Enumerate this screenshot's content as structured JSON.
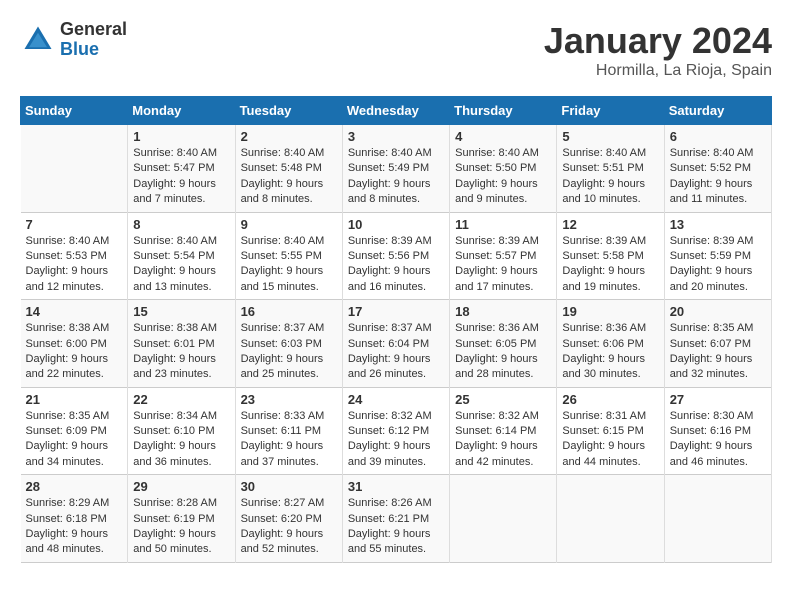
{
  "header": {
    "logo_general": "General",
    "logo_blue": "Blue",
    "month_title": "January 2024",
    "location": "Hormilla, La Rioja, Spain"
  },
  "days_of_week": [
    "Sunday",
    "Monday",
    "Tuesday",
    "Wednesday",
    "Thursday",
    "Friday",
    "Saturday"
  ],
  "weeks": [
    [
      {
        "day": "",
        "sunrise": "",
        "sunset": "",
        "daylight": ""
      },
      {
        "day": "1",
        "sunrise": "Sunrise: 8:40 AM",
        "sunset": "Sunset: 5:47 PM",
        "daylight": "Daylight: 9 hours and 7 minutes."
      },
      {
        "day": "2",
        "sunrise": "Sunrise: 8:40 AM",
        "sunset": "Sunset: 5:48 PM",
        "daylight": "Daylight: 9 hours and 8 minutes."
      },
      {
        "day": "3",
        "sunrise": "Sunrise: 8:40 AM",
        "sunset": "Sunset: 5:49 PM",
        "daylight": "Daylight: 9 hours and 8 minutes."
      },
      {
        "day": "4",
        "sunrise": "Sunrise: 8:40 AM",
        "sunset": "Sunset: 5:50 PM",
        "daylight": "Daylight: 9 hours and 9 minutes."
      },
      {
        "day": "5",
        "sunrise": "Sunrise: 8:40 AM",
        "sunset": "Sunset: 5:51 PM",
        "daylight": "Daylight: 9 hours and 10 minutes."
      },
      {
        "day": "6",
        "sunrise": "Sunrise: 8:40 AM",
        "sunset": "Sunset: 5:52 PM",
        "daylight": "Daylight: 9 hours and 11 minutes."
      }
    ],
    [
      {
        "day": "7",
        "sunrise": "Sunrise: 8:40 AM",
        "sunset": "Sunset: 5:53 PM",
        "daylight": "Daylight: 9 hours and 12 minutes."
      },
      {
        "day": "8",
        "sunrise": "Sunrise: 8:40 AM",
        "sunset": "Sunset: 5:54 PM",
        "daylight": "Daylight: 9 hours and 13 minutes."
      },
      {
        "day": "9",
        "sunrise": "Sunrise: 8:40 AM",
        "sunset": "Sunset: 5:55 PM",
        "daylight": "Daylight: 9 hours and 15 minutes."
      },
      {
        "day": "10",
        "sunrise": "Sunrise: 8:39 AM",
        "sunset": "Sunset: 5:56 PM",
        "daylight": "Daylight: 9 hours and 16 minutes."
      },
      {
        "day": "11",
        "sunrise": "Sunrise: 8:39 AM",
        "sunset": "Sunset: 5:57 PM",
        "daylight": "Daylight: 9 hours and 17 minutes."
      },
      {
        "day": "12",
        "sunrise": "Sunrise: 8:39 AM",
        "sunset": "Sunset: 5:58 PM",
        "daylight": "Daylight: 9 hours and 19 minutes."
      },
      {
        "day": "13",
        "sunrise": "Sunrise: 8:39 AM",
        "sunset": "Sunset: 5:59 PM",
        "daylight": "Daylight: 9 hours and 20 minutes."
      }
    ],
    [
      {
        "day": "14",
        "sunrise": "Sunrise: 8:38 AM",
        "sunset": "Sunset: 6:00 PM",
        "daylight": "Daylight: 9 hours and 22 minutes."
      },
      {
        "day": "15",
        "sunrise": "Sunrise: 8:38 AM",
        "sunset": "Sunset: 6:01 PM",
        "daylight": "Daylight: 9 hours and 23 minutes."
      },
      {
        "day": "16",
        "sunrise": "Sunrise: 8:37 AM",
        "sunset": "Sunset: 6:03 PM",
        "daylight": "Daylight: 9 hours and 25 minutes."
      },
      {
        "day": "17",
        "sunrise": "Sunrise: 8:37 AM",
        "sunset": "Sunset: 6:04 PM",
        "daylight": "Daylight: 9 hours and 26 minutes."
      },
      {
        "day": "18",
        "sunrise": "Sunrise: 8:36 AM",
        "sunset": "Sunset: 6:05 PM",
        "daylight": "Daylight: 9 hours and 28 minutes."
      },
      {
        "day": "19",
        "sunrise": "Sunrise: 8:36 AM",
        "sunset": "Sunset: 6:06 PM",
        "daylight": "Daylight: 9 hours and 30 minutes."
      },
      {
        "day": "20",
        "sunrise": "Sunrise: 8:35 AM",
        "sunset": "Sunset: 6:07 PM",
        "daylight": "Daylight: 9 hours and 32 minutes."
      }
    ],
    [
      {
        "day": "21",
        "sunrise": "Sunrise: 8:35 AM",
        "sunset": "Sunset: 6:09 PM",
        "daylight": "Daylight: 9 hours and 34 minutes."
      },
      {
        "day": "22",
        "sunrise": "Sunrise: 8:34 AM",
        "sunset": "Sunset: 6:10 PM",
        "daylight": "Daylight: 9 hours and 36 minutes."
      },
      {
        "day": "23",
        "sunrise": "Sunrise: 8:33 AM",
        "sunset": "Sunset: 6:11 PM",
        "daylight": "Daylight: 9 hours and 37 minutes."
      },
      {
        "day": "24",
        "sunrise": "Sunrise: 8:32 AM",
        "sunset": "Sunset: 6:12 PM",
        "daylight": "Daylight: 9 hours and 39 minutes."
      },
      {
        "day": "25",
        "sunrise": "Sunrise: 8:32 AM",
        "sunset": "Sunset: 6:14 PM",
        "daylight": "Daylight: 9 hours and 42 minutes."
      },
      {
        "day": "26",
        "sunrise": "Sunrise: 8:31 AM",
        "sunset": "Sunset: 6:15 PM",
        "daylight": "Daylight: 9 hours and 44 minutes."
      },
      {
        "day": "27",
        "sunrise": "Sunrise: 8:30 AM",
        "sunset": "Sunset: 6:16 PM",
        "daylight": "Daylight: 9 hours and 46 minutes."
      }
    ],
    [
      {
        "day": "28",
        "sunrise": "Sunrise: 8:29 AM",
        "sunset": "Sunset: 6:18 PM",
        "daylight": "Daylight: 9 hours and 48 minutes."
      },
      {
        "day": "29",
        "sunrise": "Sunrise: 8:28 AM",
        "sunset": "Sunset: 6:19 PM",
        "daylight": "Daylight: 9 hours and 50 minutes."
      },
      {
        "day": "30",
        "sunrise": "Sunrise: 8:27 AM",
        "sunset": "Sunset: 6:20 PM",
        "daylight": "Daylight: 9 hours and 52 minutes."
      },
      {
        "day": "31",
        "sunrise": "Sunrise: 8:26 AM",
        "sunset": "Sunset: 6:21 PM",
        "daylight": "Daylight: 9 hours and 55 minutes."
      },
      {
        "day": "",
        "sunrise": "",
        "sunset": "",
        "daylight": ""
      },
      {
        "day": "",
        "sunrise": "",
        "sunset": "",
        "daylight": ""
      },
      {
        "day": "",
        "sunrise": "",
        "sunset": "",
        "daylight": ""
      }
    ]
  ]
}
